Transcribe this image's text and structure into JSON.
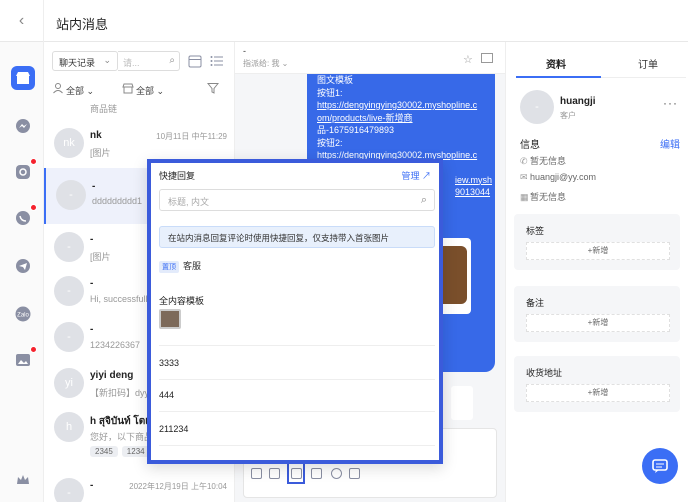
{
  "header": {
    "back_icon": "chevron-left-icon",
    "title": "站内消息"
  },
  "rail": {
    "items": [
      {
        "icon": "store-icon",
        "active": true,
        "badge": false
      },
      {
        "icon": "messenger-icon",
        "active": false,
        "badge": false
      },
      {
        "icon": "instagram-icon",
        "active": false,
        "badge": true
      },
      {
        "icon": "whatsapp-icon",
        "active": false,
        "badge": true
      },
      {
        "icon": "telegram-icon",
        "active": false,
        "badge": false
      },
      {
        "icon": "zalo-icon",
        "active": false,
        "badge": false,
        "text": "Zalo"
      },
      {
        "icon": "image-message-icon",
        "active": false,
        "badge": true
      },
      {
        "icon": "crown-icon",
        "active": false,
        "badge": false
      }
    ]
  },
  "list": {
    "record_select": "聊天记录",
    "search_placeholder": "请...",
    "filter_assignee": "全部",
    "filter_store": "全部",
    "conversations": [
      {
        "avatar": "",
        "name": "",
        "time": "",
        "preview": "商品链",
        "tags": []
      },
      {
        "avatar": "nk",
        "name": "nk",
        "time": "10月11日 中午11:29",
        "preview": "[图片",
        "tags": []
      },
      {
        "avatar": "-",
        "name": "-",
        "time": "",
        "preview": "ddddddddd1",
        "tags": [],
        "active": true
      },
      {
        "avatar": "-",
        "name": "-",
        "time": "",
        "preview": "[图片",
        "tags": []
      },
      {
        "avatar": "-",
        "name": "-",
        "time": "",
        "preview": "Hi, successfull",
        "tags": []
      },
      {
        "avatar": "-",
        "name": "-",
        "time": "",
        "preview": "1234226367",
        "tags": []
      },
      {
        "avatar": "yi",
        "name": "yiyi deng",
        "time": "",
        "preview": "【新扣码】dyyfh",
        "tags": []
      },
      {
        "avatar": "h",
        "name": "h สุจิบันท์ โตเล็ก",
        "time": "",
        "preview": "您好，以下商品",
        "tags": [
          "2345",
          "1234"
        ]
      },
      {
        "avatar": "-",
        "name": "-",
        "time": "2022年12月19日 上午10:04",
        "preview": "",
        "tags": []
      }
    ]
  },
  "chat": {
    "title": "-",
    "assignee": "指派给: 我",
    "message_lines": [
      "图文模板",
      "按钮1:",
      "https://dengyingying30002.myshopline.c",
      "om/products/live-新增商",
      "品-1675916479893",
      "按钮2:",
      "https://dengyingying30002.myshopline.c",
      "",
      "iew.mysh",
      "9013044"
    ]
  },
  "quick_reply": {
    "title": "快捷回复",
    "manage": "管理",
    "search_placeholder": "标题, 内文",
    "tip": "在站内消息回复评论时使用快捷回复，仅支持带入首张图片",
    "pinned_badge": "置顶",
    "pinned_item": "客服",
    "section_title": "全内容模板",
    "items": [
      "3333",
      "444",
      "211234"
    ]
  },
  "profile": {
    "tab_info": "资料",
    "tab_orders": "订单",
    "avatar": "-",
    "name": "huangji",
    "role": "客户",
    "info_title": "信息",
    "edit": "编辑",
    "phone": "暂无信息",
    "email": "huangji@yy.com",
    "address": "暂无信息",
    "tags_title": "标签",
    "notes_title": "备注",
    "shipping_title": "收货地址",
    "add_label": "+新增"
  },
  "colors": {
    "accent": "#3b6ef5",
    "bubble": "#3769e8",
    "highlight_border": "#3b5bdb",
    "badge": "#f5222d"
  }
}
